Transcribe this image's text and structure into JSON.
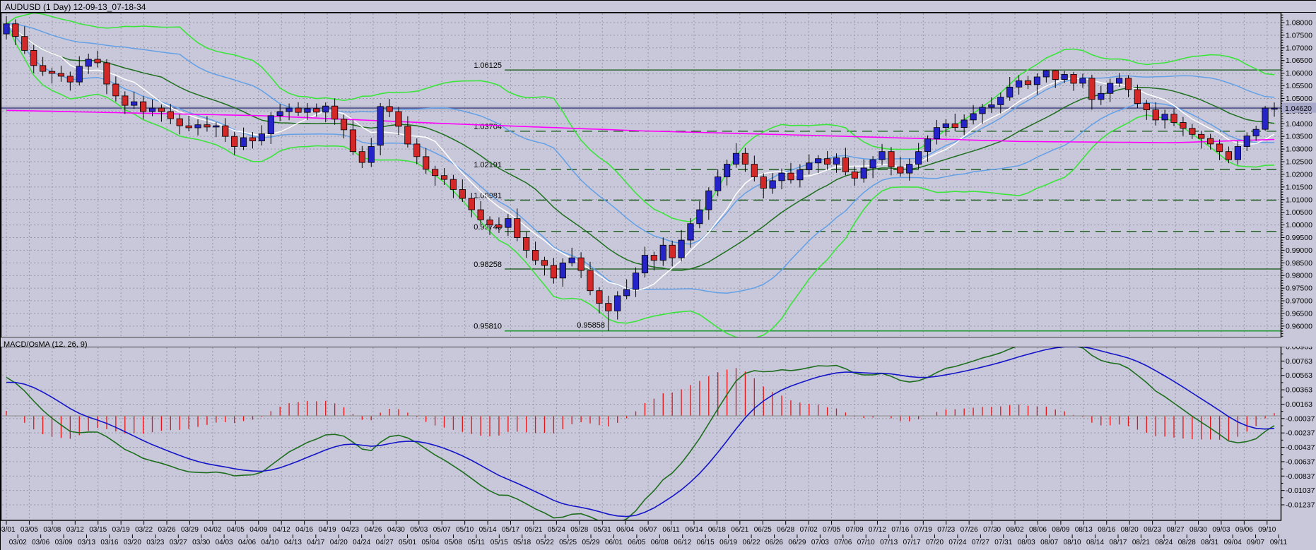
{
  "title": "AUDUSD (1 Day) 12-09-13_07-18-34",
  "indicator_label": "MACD/OsMA (12, 26, 9)",
  "colors": {
    "background": "#c8c8da",
    "grid": "#9697a6",
    "border": "#000000",
    "text": "#000000",
    "bull": "#2424c8",
    "bear": "#d42828",
    "wick": "#000000",
    "band_outer": "#3ce43c",
    "band_inner": "#64a0e6",
    "ma_fast": "#ffffff",
    "ma_slow": "#1e6e1e",
    "trend": "#ff00ff",
    "level": "#0f520f",
    "level_bright": "#1e9632",
    "price_line": "#3c3c82",
    "price_band": "#b2b2c6",
    "badge_bg": "#a8a8ca",
    "macd_line": "#1414c8",
    "macd_signal": "#1e6e1e",
    "histogram": "#e61414",
    "zero_line": "#909090"
  },
  "price_axis": {
    "labels": [
      "1.08000",
      "1.07500",
      "1.07000",
      "1.06500",
      "1.06000",
      "1.05500",
      "1.05000",
      "1.04500",
      "1.04000",
      "1.03500",
      "1.03000",
      "1.02500",
      "1.02000",
      "1.01500",
      "1.01000",
      "1.00500",
      "1.00000",
      "0.99500",
      "0.99000",
      "0.98500",
      "0.98000",
      "0.97500",
      "0.97000",
      "0.96500",
      "0.96000"
    ],
    "current_price_label": "1.04620"
  },
  "macd_axis": {
    "labels": [
      "0.00963",
      "0.00763",
      "0.00563",
      "0.00363",
      "0.00163",
      "-0.00037",
      "-0.00237",
      "-0.00437",
      "-0.00637",
      "-0.00837",
      "-0.01037",
      "-0.01237"
    ]
  },
  "date_axis": {
    "row1": [
      "03/01",
      "03/05",
      "03/08",
      "03/12",
      "03/15",
      "03/19",
      "03/22",
      "03/26",
      "03/29",
      "04/02",
      "04/05",
      "04/09",
      "04/12",
      "04/16",
      "04/19",
      "04/23",
      "04/26",
      "04/30",
      "05/03",
      "05/07",
      "05/10",
      "05/14",
      "05/17",
      "05/21",
      "05/24",
      "05/28",
      "05/31",
      "06/04",
      "06/07",
      "06/11",
      "06/14",
      "06/18",
      "06/21",
      "06/25",
      "06/28",
      "07/02",
      "07/05",
      "07/09",
      "07/12",
      "07/16",
      "07/19",
      "07/23",
      "07/26",
      "07/30",
      "08/02",
      "08/06",
      "08/09",
      "08/13",
      "08/16",
      "08/20",
      "08/23",
      "08/27",
      "08/30",
      "09/03",
      "09/06",
      "09/10"
    ],
    "row2": [
      "03/02",
      "03/06",
      "03/09",
      "03/13",
      "03/16",
      "03/20",
      "03/23",
      "03/27",
      "03/30",
      "04/03",
      "04/06",
      "04/10",
      "04/13",
      "04/17",
      "04/20",
      "04/24",
      "04/27",
      "05/01",
      "05/04",
      "05/08",
      "05/11",
      "05/15",
      "05/18",
      "05/22",
      "05/25",
      "05/29",
      "06/01",
      "06/05",
      "06/08",
      "06/12",
      "06/15",
      "06/19",
      "06/22",
      "06/26",
      "06/29",
      "07/03",
      "07/06",
      "07/10",
      "07/13",
      "07/17",
      "07/20",
      "07/24",
      "07/27",
      "07/31",
      "08/03",
      "08/07",
      "08/10",
      "08/14",
      "08/17",
      "08/21",
      "08/24",
      "08/28",
      "08/31",
      "09/04",
      "09/07",
      "09/11"
    ]
  },
  "chart_data": {
    "type": "candlestick",
    "symbol": "AUDUSD",
    "timeframe": "1 Day",
    "price_range": {
      "top": 1.0839,
      "bottom": 0.9555
    },
    "levels": [
      {
        "label": "1.06125",
        "value": 1.06125,
        "dashed": false,
        "bright": false
      },
      {
        "label": "1.03704",
        "value": 1.03704,
        "dashed": true,
        "bright": false
      },
      {
        "label": "1.02191",
        "value": 1.02191,
        "dashed": true,
        "bright": false
      },
      {
        "label": "1.00981",
        "value": 1.00981,
        "dashed": true,
        "bright": false
      },
      {
        "label": "0.99743",
        "value": 0.99743,
        "dashed": true,
        "bright": false
      },
      {
        "label": "0.98258",
        "value": 0.98258,
        "dashed": false,
        "bright": false
      },
      {
        "label": "0.95810",
        "value": 0.9581,
        "dashed": false,
        "bright": true
      }
    ],
    "low_marker": {
      "label": "0.95858",
      "value": 0.95858
    },
    "current_price": 1.0462,
    "overlays": {
      "sma_fast": 7,
      "sma_slow": 18,
      "bb_period": 20,
      "bb_outer": 2.0,
      "bb_inner": 1.0,
      "trend_line_points": [
        [
          0,
          1.0453
        ],
        [
          0.2,
          1.0432
        ],
        [
          0.35,
          1.04
        ],
        [
          0.5,
          1.0372
        ],
        [
          0.65,
          1.0352
        ],
        [
          0.8,
          1.033
        ],
        [
          0.92,
          1.0325
        ],
        [
          1,
          1.0338
        ]
      ]
    },
    "macd": {
      "fast": 12,
      "slow": 26,
      "signal": 9
    },
    "candles": [
      [
        1.0755,
        1.0825,
        1.0733,
        1.0795
      ],
      [
        1.0795,
        1.0813,
        1.0711,
        1.0745
      ],
      [
        1.0745,
        1.0785,
        1.0676,
        1.069
      ],
      [
        1.069,
        1.0712,
        1.06,
        1.063
      ],
      [
        1.063,
        1.0664,
        1.0589,
        1.0607
      ],
      [
        1.0607,
        1.0621,
        1.0559,
        1.0599
      ],
      [
        1.0599,
        1.0629,
        1.0566,
        1.0588
      ],
      [
        1.0588,
        1.0606,
        1.0531,
        1.0565
      ],
      [
        1.0565,
        1.0667,
        1.0551,
        1.0627
      ],
      [
        1.0627,
        1.0677,
        1.0597,
        1.0655
      ],
      [
        1.0655,
        1.0689,
        1.0623,
        1.0641
      ],
      [
        1.0641,
        1.0655,
        1.0517,
        1.0557
      ],
      [
        1.0557,
        1.0587,
        1.0488,
        1.051
      ],
      [
        1.051,
        1.0528,
        1.0439,
        1.0473
      ],
      [
        1.0473,
        1.0527,
        1.0459,
        1.0487
      ],
      [
        1.0487,
        1.0509,
        1.0418,
        1.0448
      ],
      [
        1.0448,
        1.0496,
        1.043,
        1.0462
      ],
      [
        1.0462,
        1.0476,
        1.0408,
        1.0448
      ],
      [
        1.0448,
        1.0478,
        1.0398,
        1.042
      ],
      [
        1.042,
        1.0438,
        1.0358,
        1.0392
      ],
      [
        1.0392,
        1.0432,
        1.037,
        1.0384
      ],
      [
        1.0384,
        1.0418,
        1.0354,
        1.0396
      ],
      [
        1.0396,
        1.043,
        1.0369,
        1.0387
      ],
      [
        1.0387,
        1.0406,
        1.0347,
        1.0392
      ],
      [
        1.0392,
        1.0422,
        1.0328,
        1.035
      ],
      [
        1.035,
        1.0368,
        1.0276,
        1.031
      ],
      [
        1.031,
        1.0385,
        1.0296,
        1.0345
      ],
      [
        1.0345,
        1.0367,
        1.0302,
        1.0332
      ],
      [
        1.0332,
        1.0394,
        1.0314,
        1.036
      ],
      [
        1.036,
        1.0446,
        1.032,
        1.0432
      ],
      [
        1.0432,
        1.0478,
        1.041,
        1.0448
      ],
      [
        1.0448,
        1.048,
        1.0414,
        1.0462
      ],
      [
        1.0462,
        1.0485,
        1.0431,
        1.0445
      ],
      [
        1.0445,
        1.0482,
        1.0415,
        1.046
      ],
      [
        1.046,
        1.048,
        1.0428,
        1.0446
      ],
      [
        1.0446,
        1.0484,
        1.0406,
        1.047
      ],
      [
        1.047,
        1.05,
        1.0396,
        1.0418
      ],
      [
        1.0418,
        1.0436,
        1.0342,
        1.0376
      ],
      [
        1.0376,
        1.0416,
        1.0276,
        1.029
      ],
      [
        1.029,
        1.0312,
        1.0225,
        1.0247
      ],
      [
        1.0247,
        1.0344,
        1.0229,
        1.031
      ],
      [
        1.0315,
        1.0482,
        1.0275,
        1.0468
      ],
      [
        1.0468,
        1.0498,
        1.0426,
        1.0448
      ],
      [
        1.0448,
        1.0466,
        1.0356,
        1.039
      ],
      [
        1.039,
        1.043,
        1.0306,
        1.032
      ],
      [
        1.032,
        1.0342,
        1.024,
        1.027
      ],
      [
        1.027,
        1.0304,
        1.0202,
        1.022
      ],
      [
        1.022,
        1.0234,
        1.0155,
        1.0195
      ],
      [
        1.0195,
        1.0225,
        1.0158,
        1.018
      ],
      [
        1.018,
        1.0198,
        1.0106,
        1.014
      ],
      [
        1.014,
        1.018,
        1.0091,
        1.0105
      ],
      [
        1.0105,
        1.0127,
        1.003,
        1.006
      ],
      [
        1.006,
        1.0094,
        1.0002,
        1.002
      ],
      [
        1.002,
        1.0034,
        0.996,
        1.0
      ],
      [
        1.0,
        1.003,
        0.9968,
        0.999
      ],
      [
        0.999,
        1.0043,
        0.9956,
        1.0025
      ],
      [
        1.0025,
        1.0065,
        0.9936,
        0.995
      ],
      [
        0.995,
        0.9972,
        0.987,
        0.99
      ],
      [
        0.99,
        0.9934,
        0.9842,
        0.986
      ],
      [
        0.986,
        0.9874,
        0.98,
        0.984
      ],
      [
        0.984,
        0.987,
        0.9768,
        0.979
      ],
      [
        0.979,
        0.9868,
        0.9756,
        0.985
      ],
      [
        0.985,
        0.991,
        0.9836,
        0.987
      ],
      [
        0.987,
        0.9892,
        0.979,
        0.982
      ],
      [
        0.982,
        0.9854,
        0.9722,
        0.974
      ],
      [
        0.974,
        0.9754,
        0.965,
        0.969
      ],
      [
        0.969,
        0.972,
        0.9581,
        0.966
      ],
      [
        0.966,
        0.9738,
        0.9626,
        0.972
      ],
      [
        0.972,
        0.9785,
        0.9706,
        0.9745
      ],
      [
        0.9745,
        0.9832,
        0.9715,
        0.981
      ],
      [
        0.981,
        0.9914,
        0.9792,
        0.988
      ],
      [
        0.988,
        0.9894,
        0.982,
        0.986
      ],
      [
        0.986,
        0.995,
        0.9838,
        0.992
      ],
      [
        0.992,
        0.9938,
        0.9836,
        0.987
      ],
      [
        0.987,
        0.998,
        0.9856,
        0.994
      ],
      [
        0.994,
        1.0027,
        0.991,
        1.0005
      ],
      [
        1.0005,
        1.0094,
        0.9987,
        1.006
      ],
      [
        1.006,
        1.0149,
        1.002,
        1.0135
      ],
      [
        1.0135,
        1.022,
        1.0113,
        1.019
      ],
      [
        1.019,
        1.0258,
        1.0156,
        1.024
      ],
      [
        1.024,
        1.0323,
        1.0226,
        1.0283
      ],
      [
        1.0283,
        1.0305,
        1.021,
        1.024
      ],
      [
        1.024,
        1.0274,
        1.0172,
        1.019
      ],
      [
        1.019,
        1.0204,
        1.0105,
        1.0145
      ],
      [
        1.0145,
        1.0205,
        1.0123,
        1.0175
      ],
      [
        1.0175,
        1.0223,
        1.0141,
        1.0205
      ],
      [
        1.0205,
        1.0245,
        1.0164,
        1.0178
      ],
      [
        1.0178,
        1.024,
        1.0148,
        1.0218
      ],
      [
        1.0218,
        1.0279,
        1.02,
        1.0245
      ],
      [
        1.0245,
        1.0276,
        1.0205,
        1.0262
      ],
      [
        1.0262,
        1.0292,
        1.0218,
        1.024
      ],
      [
        1.024,
        1.0283,
        1.0206,
        1.0265
      ],
      [
        1.0265,
        1.0305,
        1.0196,
        1.021
      ],
      [
        1.021,
        1.0232,
        1.0155,
        1.0185
      ],
      [
        1.0185,
        1.0259,
        1.0167,
        1.0225
      ],
      [
        1.0225,
        1.0272,
        1.0185,
        1.0258
      ],
      [
        1.0258,
        1.032,
        1.0236,
        1.029
      ],
      [
        1.029,
        1.0308,
        1.0196,
        1.023
      ],
      [
        1.023,
        1.027,
        1.0191,
        1.0205
      ],
      [
        1.0205,
        1.0262,
        1.0175,
        1.024
      ],
      [
        1.024,
        1.0324,
        1.0222,
        1.029
      ],
      [
        1.029,
        1.0354,
        1.025,
        1.034
      ],
      [
        1.034,
        1.0415,
        1.0318,
        1.0385
      ],
      [
        1.0385,
        1.0418,
        1.0351,
        1.04
      ],
      [
        1.04,
        1.044,
        1.0371,
        1.0385
      ],
      [
        1.0385,
        1.0437,
        1.0355,
        1.0415
      ],
      [
        1.0415,
        1.0474,
        1.0397,
        1.044
      ],
      [
        1.044,
        1.0479,
        1.04,
        1.0465
      ],
      [
        1.0465,
        1.0505,
        1.0443,
        1.0475
      ],
      [
        1.0475,
        1.0523,
        1.0441,
        1.0505
      ],
      [
        1.0505,
        1.0585,
        1.0491,
        1.0545
      ],
      [
        1.0545,
        1.0592,
        1.0515,
        1.057
      ],
      [
        1.057,
        1.0589,
        1.0537,
        1.0555
      ],
      [
        1.0555,
        1.0599,
        1.0515,
        1.0585
      ],
      [
        1.0585,
        1.0613,
        1.0563,
        1.061
      ],
      [
        1.061,
        1.0612,
        1.0541,
        1.0575
      ],
      [
        1.0575,
        1.0609,
        1.0561,
        1.0595
      ],
      [
        1.0595,
        1.0605,
        1.053,
        1.056
      ],
      [
        1.056,
        1.0598,
        1.0542,
        1.058
      ],
      [
        1.058,
        1.0594,
        1.0456,
        1.0496
      ],
      [
        1.0496,
        1.055,
        1.0474,
        1.052
      ],
      [
        1.052,
        1.0578,
        1.0486,
        1.056
      ],
      [
        1.056,
        1.06,
        1.0546,
        1.058
      ],
      [
        1.058,
        1.0592,
        1.0505,
        1.0535
      ],
      [
        1.0535,
        1.0555,
        1.0462,
        1.048
      ],
      [
        1.048,
        1.0494,
        1.0415,
        1.0455
      ],
      [
        1.0455,
        1.0485,
        1.0393,
        1.0415
      ],
      [
        1.0415,
        1.0456,
        1.0381,
        1.0438
      ],
      [
        1.0438,
        1.046,
        1.0391,
        1.0405
      ],
      [
        1.0405,
        1.0427,
        1.0352,
        1.0382
      ],
      [
        1.0382,
        1.04,
        1.034,
        1.0358
      ],
      [
        1.0358,
        1.0372,
        1.0302,
        1.0342
      ],
      [
        1.0342,
        1.036,
        1.0298,
        1.032
      ],
      [
        1.032,
        1.0338,
        1.0256,
        1.029
      ],
      [
        1.029,
        1.031,
        1.0244,
        1.0258
      ],
      [
        1.0258,
        1.0332,
        1.0238,
        1.031
      ],
      [
        1.031,
        1.0366,
        1.0292,
        1.0352
      ],
      [
        1.0352,
        1.0392,
        1.0332,
        1.0378
      ],
      [
        1.0378,
        1.047,
        1.0372,
        1.0462
      ],
      [
        1.0462,
        1.0484,
        1.0428,
        1.0462
      ]
    ]
  }
}
